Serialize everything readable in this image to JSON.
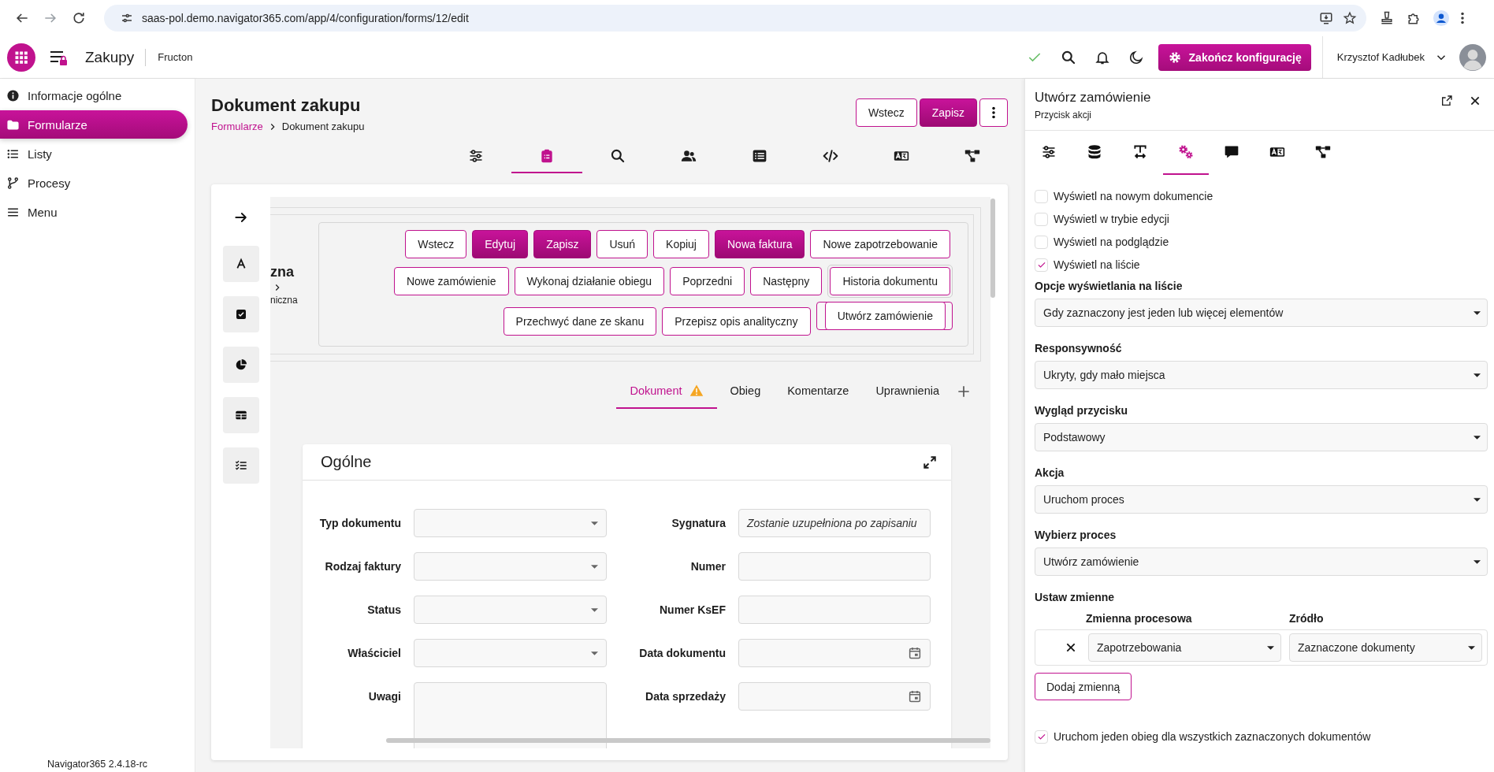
{
  "browser": {
    "url": "saas-pol.demo.navigator365.com/app/4/configuration/forms/12/edit"
  },
  "header": {
    "app_title": "Zakupy",
    "company": "Fructon",
    "finish_button": "Zakończ konfigurację",
    "user_name": "Krzysztof Kadłubek"
  },
  "sidebar": {
    "items": [
      {
        "label": "Informacje ogólne",
        "kind": "info",
        "selected": false
      },
      {
        "label": "Formularze",
        "kind": "folder",
        "selected": true
      },
      {
        "label": "Listy",
        "kind": "list",
        "selected": false
      },
      {
        "label": "Procesy",
        "kind": "branch",
        "selected": false
      },
      {
        "label": "Menu",
        "kind": "menu",
        "selected": false
      }
    ],
    "version": "Navigator365 2.4.18-rc"
  },
  "page": {
    "title": "Dokument zakupu",
    "breadcrumb": [
      "Formularze",
      "Dokument zakupu"
    ],
    "buttons": [
      {
        "label": "Wstecz",
        "kind": "outline"
      },
      {
        "label": "Zapisz",
        "kind": "primary"
      }
    ],
    "tool_tabs": [
      {
        "kind": "sliders",
        "selected": false
      },
      {
        "kind": "clipboard",
        "selected": true
      },
      {
        "kind": "search",
        "selected": false
      },
      {
        "kind": "users",
        "selected": false
      },
      {
        "kind": "tablelist",
        "selected": false
      },
      {
        "kind": "code",
        "selected": false
      },
      {
        "kind": "translate",
        "selected": false
      },
      {
        "kind": "flow",
        "selected": false
      }
    ]
  },
  "canvas": {
    "partial_title": "zna",
    "partial_subtitle": "niczna",
    "action_rows": [
      {
        "buttons": [
          {
            "label": "Wstecz",
            "kind": "outline",
            "selected": false,
            "hovered": false
          },
          {
            "label": "Edytuj",
            "kind": "primary",
            "selected": false,
            "hovered": false
          },
          {
            "label": "Zapisz",
            "kind": "primary",
            "selected": false,
            "hovered": false
          },
          {
            "label": "Usuń",
            "kind": "outline",
            "selected": false,
            "hovered": false
          },
          {
            "label": "Kopiuj",
            "kind": "outline",
            "selected": false,
            "hovered": false
          },
          {
            "label": "Nowa faktura",
            "kind": "primary",
            "selected": false,
            "hovered": false
          },
          {
            "label": "Nowe zapotrzebowanie",
            "kind": "outline",
            "selected": false,
            "hovered": false
          }
        ]
      },
      {
        "buttons": [
          {
            "label": "Nowe zamówienie",
            "kind": "outline",
            "selected": false,
            "hovered": false
          },
          {
            "label": "Wykonaj działanie obiegu",
            "kind": "outline",
            "selected": false,
            "hovered": false
          },
          {
            "label": "Poprzedni",
            "kind": "outline",
            "selected": false,
            "hovered": false
          },
          {
            "label": "Następny",
            "kind": "outline",
            "selected": false,
            "hovered": false
          },
          {
            "label": "Historia dokumentu",
            "kind": "outline",
            "selected": false,
            "hovered": true
          }
        ]
      },
      {
        "buttons": [
          {
            "label": "Przechwyć dane ze skanu",
            "kind": "outline",
            "selected": false,
            "hovered": false
          },
          {
            "label": "Przepisz opis analityczny",
            "kind": "outline",
            "selected": false,
            "hovered": false
          },
          {
            "label": "Utwórz zamówienie",
            "kind": "outline",
            "selected": true,
            "hovered": false
          }
        ]
      }
    ],
    "doc_tabs": [
      {
        "label": "Dokument",
        "selected": true,
        "warning": true
      },
      {
        "label": "Obieg",
        "selected": false,
        "warning": false
      },
      {
        "label": "Komentarze",
        "selected": false,
        "warning": false
      },
      {
        "label": "Uprawnienia",
        "selected": false,
        "warning": false
      }
    ],
    "section": {
      "title": "Ogólne",
      "left_fields": [
        {
          "label": "Typ dokumentu",
          "kind": "select"
        },
        {
          "label": "Rodzaj faktury",
          "kind": "select"
        },
        {
          "label": "Status",
          "kind": "select"
        },
        {
          "label": "Właściciel",
          "kind": "select"
        },
        {
          "label": "Uwagi",
          "kind": "textarea"
        }
      ],
      "right_fields": [
        {
          "label": "Sygnatura",
          "kind": "text",
          "value": "Zostanie uzupełniona po zapisaniu"
        },
        {
          "label": "Numer",
          "kind": "text"
        },
        {
          "label": "Numer KsEF",
          "kind": "text"
        },
        {
          "label": "Data dokumentu",
          "kind": "date"
        },
        {
          "label": "Data sprzedaży",
          "kind": "date"
        }
      ]
    }
  },
  "panel": {
    "title": "Utwórz zamówienie",
    "subtitle": "Przycisk akcji",
    "tabs": [
      {
        "kind": "sliders",
        "selected": false
      },
      {
        "kind": "database",
        "selected": false
      },
      {
        "kind": "textwidth",
        "selected": false
      },
      {
        "kind": "gears",
        "selected": true
      },
      {
        "kind": "comment",
        "selected": false
      },
      {
        "kind": "translate",
        "selected": false
      },
      {
        "kind": "flow",
        "selected": false
      }
    ],
    "checkboxes": [
      {
        "label": "Wyświetl na nowym dokumencie",
        "checked": false
      },
      {
        "label": "Wyświetl w trybie edycji",
        "checked": false
      },
      {
        "label": "Wyświetl na podglądzie",
        "checked": false
      },
      {
        "label": "Wyświetl na liście",
        "checked": true
      }
    ],
    "selects": [
      {
        "label": "Opcje wyświetlania na liście",
        "value": "Gdy zaznaczony jest jeden lub więcej elementów"
      },
      {
        "label": "Responsywność",
        "value": "Ukryty, gdy mało miejsca"
      },
      {
        "label": "Wygląd przycisku",
        "value": "Podstawowy"
      },
      {
        "label": "Akcja",
        "value": "Uruchom proces"
      },
      {
        "label": "Wybierz proces",
        "value": "Utwórz zamówienie"
      }
    ],
    "variables": {
      "label": "Ustaw zmienne",
      "columns": [
        "Zmienna procesowa",
        "Zródło"
      ],
      "rows": [
        {
          "variable": "Zapotrzebowania",
          "source": "Zaznaczone dokumenty"
        }
      ],
      "add_button": "Dodaj zmienną"
    },
    "single_flow": {
      "label": "Uruchom jeden obieg dla wszystkich zaznaczonych dokumentów",
      "checked": true
    }
  }
}
